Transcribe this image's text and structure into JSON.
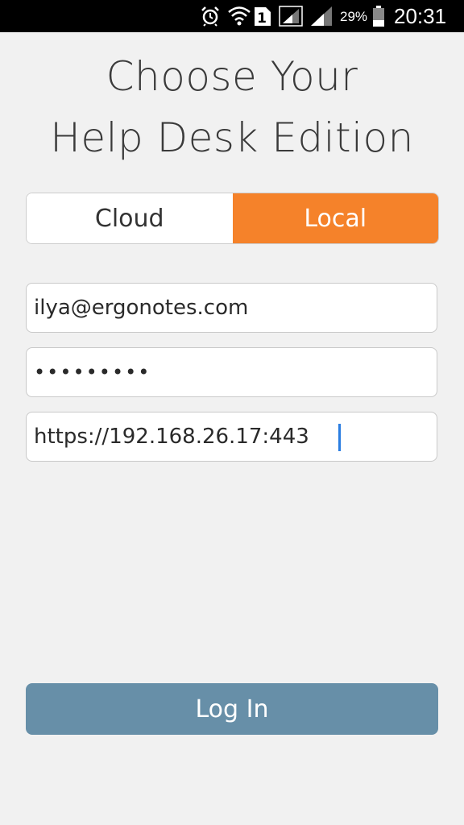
{
  "status_bar": {
    "sim_number": "1",
    "battery_percent": "29%",
    "time": "20:31",
    "icons": [
      "alarm-icon",
      "wifi-icon",
      "sim-icon",
      "signal-icon",
      "signal-icon",
      "battery-icon"
    ]
  },
  "title": {
    "line1": "Choose Your",
    "line2": "Help Desk Edition"
  },
  "edition_toggle": {
    "options": [
      {
        "label": "Cloud",
        "selected": false
      },
      {
        "label": "Local",
        "selected": true
      }
    ]
  },
  "form": {
    "email_value": "ilya@ergonotes.com",
    "password_value": "•••••••••",
    "server_value": "https://192.168.26.17:443"
  },
  "login_button_label": "Log In",
  "colors": {
    "accent": "#f5822a",
    "button": "#678fa8",
    "background": "#f1f1f1"
  }
}
